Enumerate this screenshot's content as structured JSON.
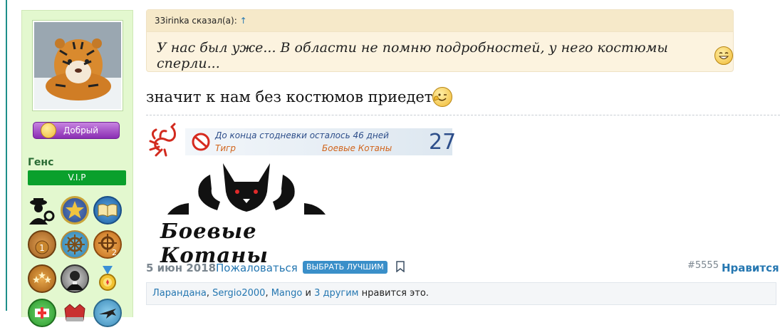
{
  "user": {
    "name": "Генс",
    "title": "V.I.P",
    "reputation_label": "Добрый"
  },
  "post": {
    "quote_author": "33irinka сказал(а):",
    "quote_arrow": "↑",
    "quote_text": "У нас был уже... В области не помню подробностей, у него костюмы сперли...",
    "message_text": "значит к нам без костюмов приедет",
    "date": "5 июн 2018",
    "report_label": "Пожаловаться",
    "best_label": "ВЫБРАТЬ ЛУЧШИМ",
    "post_number": "#5555",
    "like_label": "Нравится"
  },
  "signature": {
    "countdown_line1": "До конца стодневки осталось 46 дней",
    "countdown_name": "Тигр",
    "countdown_team": "Боевые Котаны",
    "countdown_days": "27",
    "logo_text": "Боевые Котаны"
  },
  "likes": {
    "user1": "Ларандана",
    "sep1": ", ",
    "user2": "Sergio2000",
    "sep2": ", ",
    "user3": "Mango",
    "and": " и ",
    "others": "3 другим",
    "suffix": " нравится это."
  },
  "colors": {
    "sidebar_bg": "#e3f8cf",
    "vip_green": "#0aa02c",
    "link_blue": "#2577b1",
    "quote_bg": "#fcf3df",
    "reputation_purple": "#8a2db3"
  },
  "icons": {
    "award_icons": [
      "detective-icon",
      "star-medal-icon",
      "book-icon",
      "bronze-medal-icon",
      "ship-wheel-icon",
      "ship-wheel-2-icon",
      "stars-medal-icon",
      "portrait-icon",
      "gold-medal-icon",
      "first-aid-icon",
      "crown-icon",
      "plane-icon"
    ]
  }
}
